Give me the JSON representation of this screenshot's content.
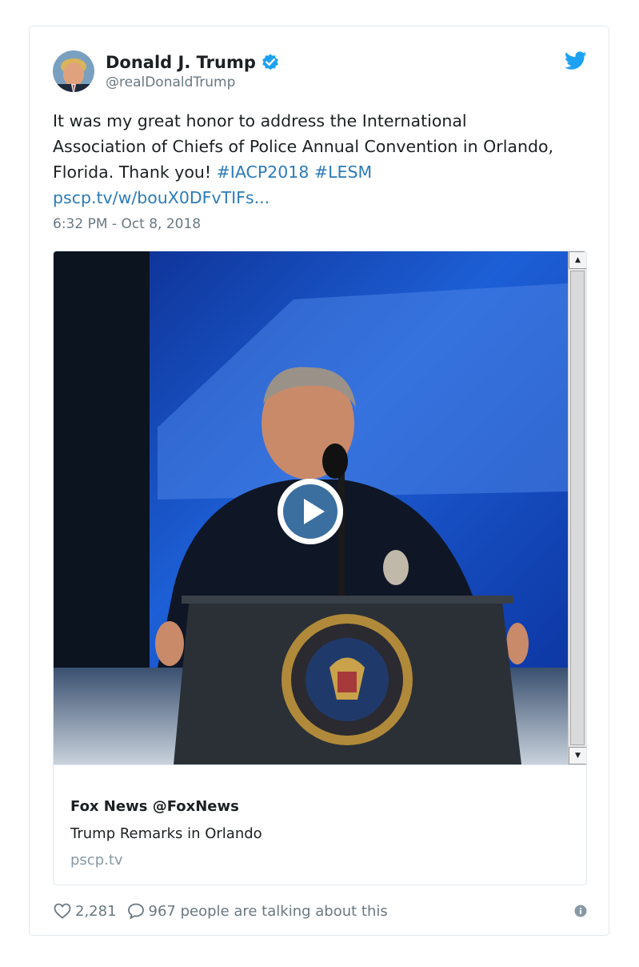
{
  "tweet": {
    "author_name": "Donald J. Trump",
    "handle": "@realDonaldTrump",
    "text_plain": "It was my great honor to address the International Association of Chiefs of Police Annual Convention in Orlando, Florida. Thank you! ",
    "hashtag_1": "#IACP2018",
    "hashtag_2": "#LESM",
    "link": "pscp.tv/w/bouX0DFvTIFs...",
    "timestamp": "6:32 PM - Oct 8, 2018"
  },
  "media_card": {
    "source": "Fox News @FoxNews",
    "title": "Trump Remarks in Orlando",
    "domain": "pscp.tv"
  },
  "footer": {
    "likes": "2,281",
    "talking": "967 people are talking about this"
  },
  "icons": {
    "verified": "verified-badge-icon",
    "twitter": "twitter-bird-icon",
    "play": "play-icon",
    "like": "heart-icon",
    "reply": "speech-bubble-icon",
    "info": "info-icon"
  },
  "colors": {
    "link": "#2b7bb9",
    "verified": "#1da1f2",
    "secondary_text": "#697882",
    "play_button": "#3b6fa0"
  }
}
